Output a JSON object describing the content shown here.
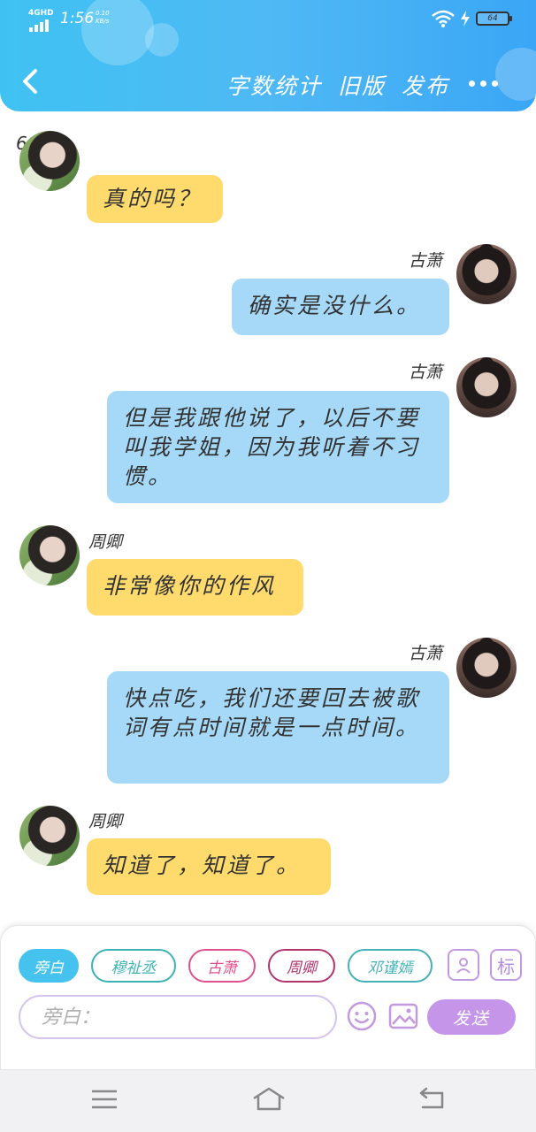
{
  "status_bar": {
    "network": "4GHD",
    "time": "1:56",
    "speed": "0.10 KB/s",
    "battery": "64"
  },
  "header": {
    "actions": [
      "字数统计",
      "旧版",
      "发布"
    ]
  },
  "chat": {
    "chapter": "6.",
    "messages": [
      {
        "side": "left",
        "name": "",
        "text": "真的吗？",
        "color": "yellow"
      },
      {
        "side": "right",
        "name": "古萧",
        "text": "确实是没什么。",
        "color": "blue"
      },
      {
        "side": "right",
        "name": "古萧",
        "text": "但是我跟他说了，以后不要叫我学姐，因为我听着不习惯。",
        "color": "blue"
      },
      {
        "side": "left",
        "name": "周卿",
        "text": "非常像你的作风",
        "color": "yellow"
      },
      {
        "side": "right",
        "name": "古萧",
        "text": "快点吃，我们还要回去被歌词有点时间就是一点时间。",
        "color": "blue"
      },
      {
        "side": "left",
        "name": "周卿",
        "text": "知道了，知道了。",
        "color": "yellow"
      }
    ]
  },
  "composer": {
    "roles": [
      {
        "label": "旁白",
        "color": "#46c2ee",
        "active": true
      },
      {
        "label": "穆祉丞",
        "color": "#3db3b3",
        "active": false
      },
      {
        "label": "古萧",
        "color": "#e0508e",
        "active": false
      },
      {
        "label": "周卿",
        "color": "#b2356f",
        "active": false
      },
      {
        "label": "邓谨嫣",
        "color": "#45b1b8",
        "active": false
      }
    ],
    "tag_label": "标",
    "input_placeholder": "旁白：",
    "send_label": "发送"
  },
  "colors": {
    "header": "#46b8f4",
    "bubble_yellow": "#ffdb6e",
    "bubble_blue": "#a6d9f7",
    "send": "#c595ea"
  }
}
